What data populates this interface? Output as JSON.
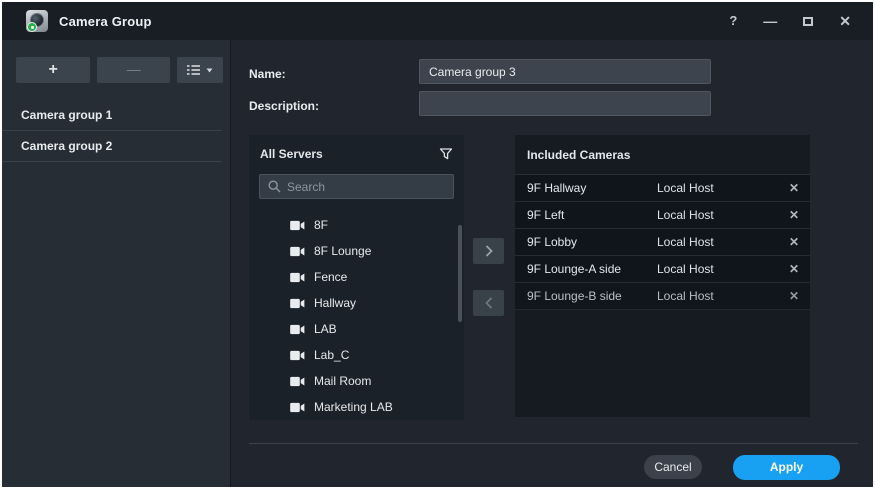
{
  "window": {
    "title": "Camera Group",
    "controls": {
      "help": "?",
      "minimize": "—",
      "close": "✕"
    }
  },
  "sidebar": {
    "toolbar": {
      "add_label": "+",
      "remove_label": "—"
    },
    "groups": [
      "Camera group 1",
      "Camera group 2"
    ]
  },
  "form": {
    "name_label": "Name:",
    "name_value": "Camera group 3",
    "description_label": "Description:",
    "description_value": ""
  },
  "servers_panel": {
    "title": "All Servers",
    "search_placeholder": "Search",
    "cameras": [
      "8F",
      "8F Lounge",
      "Fence",
      "Hallway",
      "LAB",
      "Lab_C",
      "Mail Room",
      "Marketing LAB"
    ]
  },
  "included_panel": {
    "title": "Included Cameras",
    "remove_glyph": "✕",
    "rows": [
      {
        "name": "9F Hallway",
        "server": "Local Host"
      },
      {
        "name": "9F Left",
        "server": "Local Host"
      },
      {
        "name": "9F Lobby",
        "server": "Local Host"
      },
      {
        "name": "9F Lounge-A side",
        "server": "Local Host"
      },
      {
        "name": "9F Lounge-B side",
        "server": "Local Host"
      }
    ]
  },
  "footer": {
    "cancel_label": "Cancel",
    "apply_label": "Apply"
  },
  "colors": {
    "accent": "#18a0f2",
    "window_bg": "#21262e",
    "titlebar_bg": "#191e24",
    "sidebar_bg": "#272d35",
    "panel_bg": "#1b2129",
    "row_bg": "#10151b",
    "badge_green": "#27b24b"
  }
}
